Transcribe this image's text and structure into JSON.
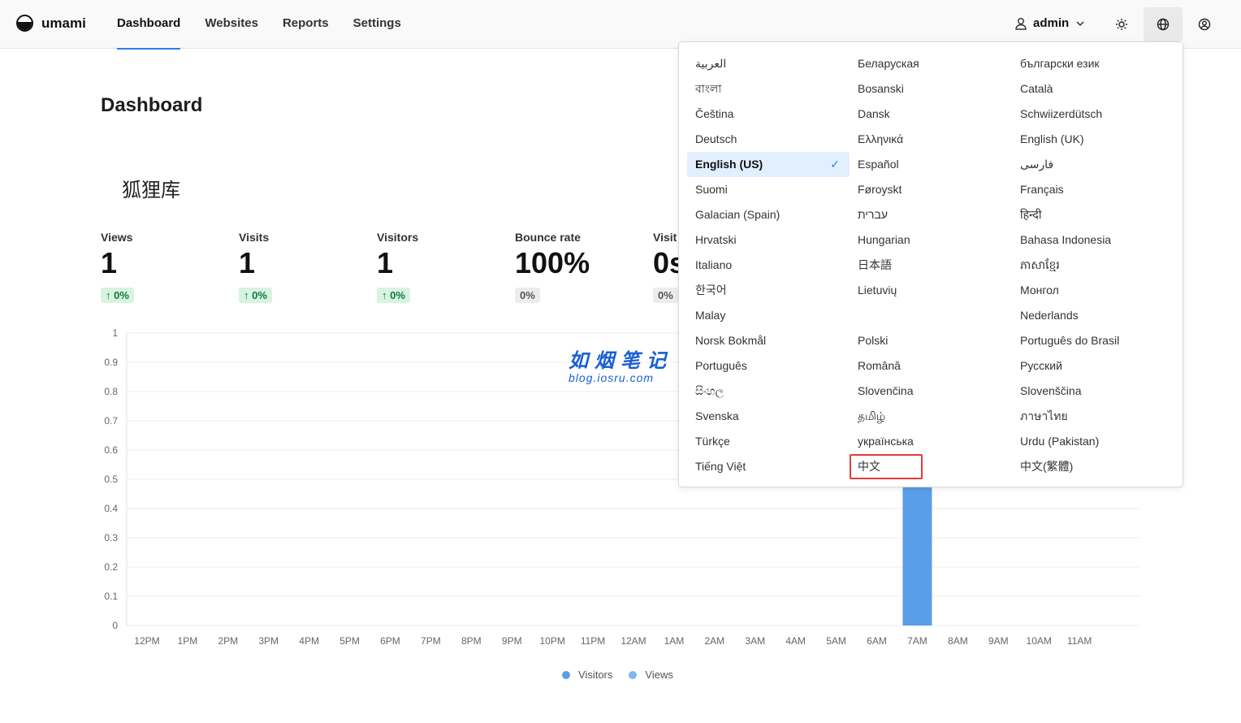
{
  "app": {
    "name": "umami"
  },
  "nav": {
    "items": [
      "Dashboard",
      "Websites",
      "Reports",
      "Settings"
    ],
    "active": "Dashboard"
  },
  "user": {
    "name": "admin"
  },
  "page": {
    "title": "Dashboard",
    "site_name": "狐狸库"
  },
  "metrics": [
    {
      "label": "Views",
      "value": "1",
      "change": "0%",
      "trend": "up"
    },
    {
      "label": "Visits",
      "value": "1",
      "change": "0%",
      "trend": "up"
    },
    {
      "label": "Visitors",
      "value": "1",
      "change": "0%",
      "trend": "up"
    },
    {
      "label": "Bounce rate",
      "value": "100%",
      "change": "0%",
      "trend": "neutral"
    },
    {
      "label": "Visit",
      "value": "0s",
      "change": "0%",
      "trend": "neutral"
    }
  ],
  "watermark": {
    "cn": "如烟笔记",
    "url": "blog.iosru.com"
  },
  "language_menu": {
    "selected": "English (US)",
    "highlighted": "中文",
    "items": [
      "العربية",
      "Беларуская",
      "български език",
      "বাংলা",
      "Bosanski",
      "Català",
      "Čeština",
      "Dansk",
      "Schwiizerdütsch",
      "Deutsch",
      "Ελληνικά",
      "English (UK)",
      "English (US)",
      "Español",
      "فارسی",
      "Suomi",
      "Føroyskt",
      "Français",
      "Galacian (Spain)",
      "עברית",
      "हिन्दी",
      "Hrvatski",
      "Hungarian",
      "Bahasa Indonesia",
      "Italiano",
      "日本語",
      "ភាសាខ្មែរ",
      "한국어",
      "Lietuvių",
      "Монгол",
      "Malay",
      "",
      "Nederlands",
      "Norsk Bokmål",
      "Polski",
      "Português do Brasil",
      "Português",
      "Română",
      "Русский",
      "සිංහල",
      "Slovenčina",
      "Slovenščina",
      "Svenska",
      "தமிழ்",
      "ภาษาไทย",
      "Türkçe",
      "українська",
      "Urdu (Pakistan)",
      "Tiếng Việt",
      "中文",
      "中文(繁體)"
    ]
  },
  "chart_data": {
    "type": "bar",
    "categories": [
      "12PM",
      "1PM",
      "2PM",
      "3PM",
      "4PM",
      "5PM",
      "6PM",
      "7PM",
      "8PM",
      "9PM",
      "10PM",
      "11PM",
      "12AM",
      "1AM",
      "2AM",
      "3AM",
      "4AM",
      "5AM",
      "6AM",
      "7AM",
      "8AM",
      "9AM",
      "10AM",
      "11AM"
    ],
    "series": [
      {
        "name": "Visitors",
        "color": "#5a9ee8",
        "values": [
          0,
          0,
          0,
          0,
          0,
          0,
          0,
          0,
          0,
          0,
          0,
          0,
          0,
          0,
          0,
          0,
          0,
          0,
          0,
          1,
          0,
          0,
          0,
          0
        ]
      },
      {
        "name": "Views",
        "color": "#80b6ef",
        "values": [
          0,
          0,
          0,
          0,
          0,
          0,
          0,
          0,
          0,
          0,
          0,
          0,
          0,
          0,
          0,
          0,
          0,
          0,
          0,
          1,
          0,
          0,
          0,
          0
        ]
      }
    ],
    "y_ticks": [
      "0",
      "0.1",
      "0.2",
      "0.3",
      "0.4",
      "0.5",
      "0.6",
      "0.7",
      "0.8",
      "0.9",
      "1"
    ],
    "ylim": [
      0,
      1
    ],
    "grid": true,
    "legend": "bottom"
  }
}
